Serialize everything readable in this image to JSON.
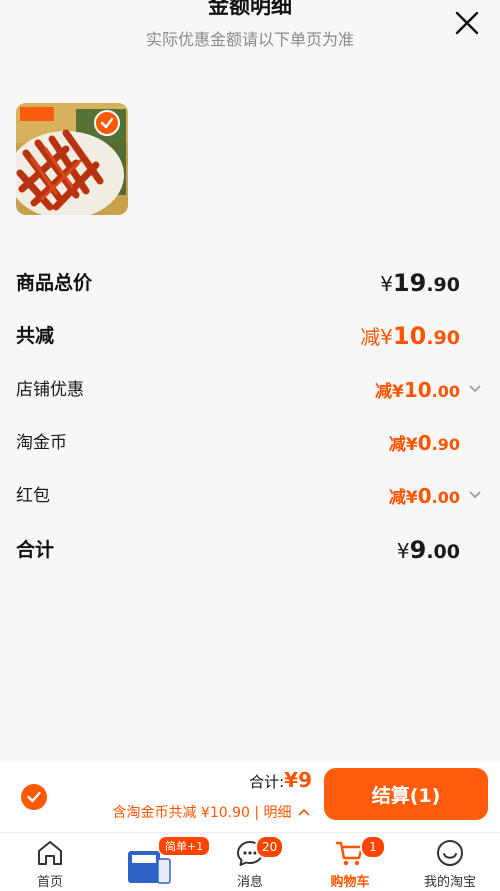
{
  "header": {
    "title": "金额明细",
    "subtitle": "实际优惠金额请以下单页为准"
  },
  "rows": [
    {
      "label": "商品总价",
      "prefix": "¥",
      "int": "19",
      "dec": ".90"
    },
    {
      "label": "共减",
      "prefix": "减¥",
      "int": "10",
      "dec": ".90"
    },
    {
      "label": "店铺优惠",
      "prefix": "减¥",
      "int": "10",
      "dec": ".00"
    },
    {
      "label": "淘金币",
      "prefix": "减¥",
      "int": "0",
      "dec": ".90"
    },
    {
      "label": "红包",
      "prefix": "减¥",
      "int": "0",
      "dec": ".00"
    },
    {
      "label": "合计",
      "prefix": "¥",
      "int": "9",
      "dec": ".00"
    }
  ],
  "checkout": {
    "total_label": "合计:",
    "total_amount": "¥9",
    "discount_text": "含淘金币共减 ¥10.90 | 明细",
    "pay_label": "结算(1)"
  },
  "tabbar": {
    "items": [
      {
        "label": "首页"
      },
      {
        "label": ""
      },
      {
        "label": "消息",
        "badge": "20"
      },
      {
        "label": "购物车",
        "badge": "1"
      },
      {
        "label": "我的淘宝"
      }
    ],
    "promo_pill": "简单+1"
  },
  "colors": {
    "accent": "#ff5500",
    "button": "#ff5d0c"
  }
}
